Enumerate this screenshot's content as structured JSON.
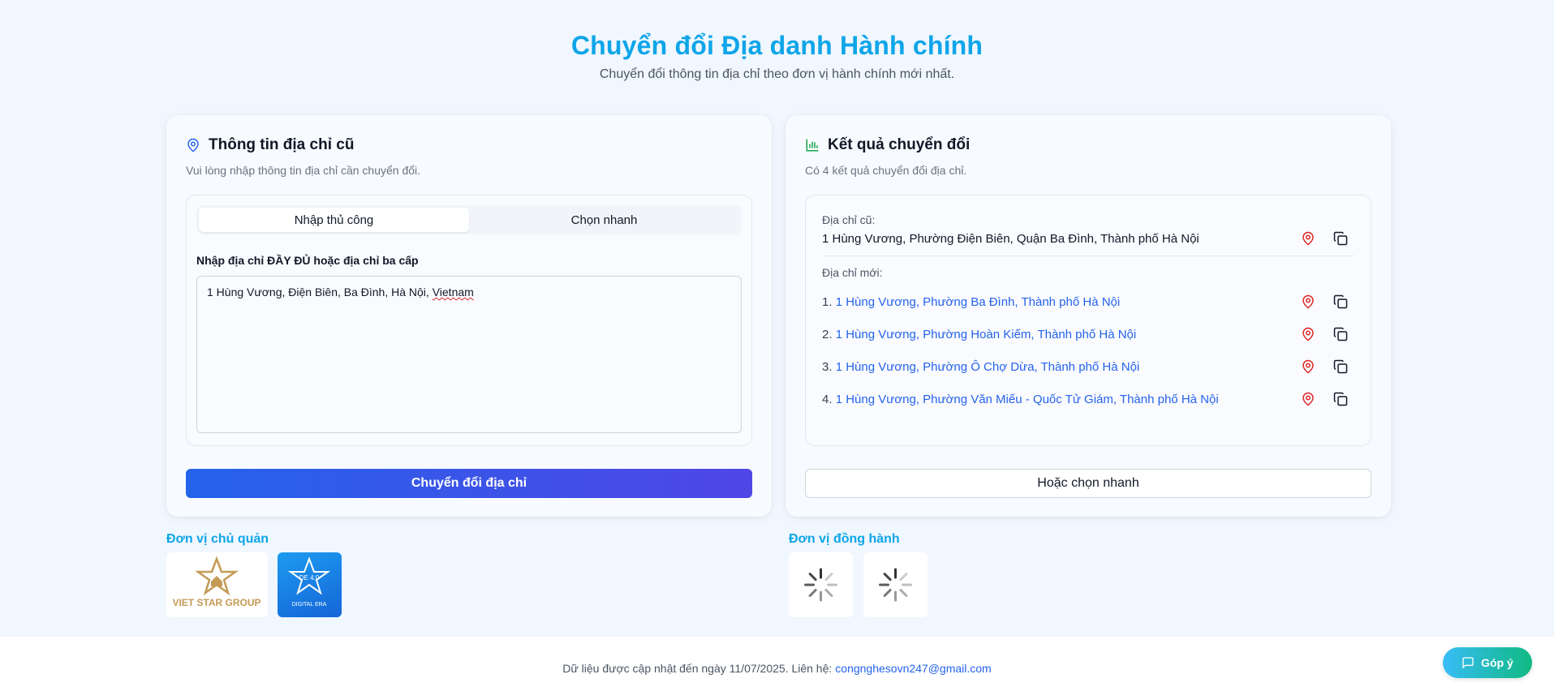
{
  "header": {
    "title": "Chuyển đổi Địa danh Hành chính",
    "subtitle": "Chuyển đổi thông tin địa chỉ theo đơn vị hành chính mới nhất."
  },
  "old_panel": {
    "title": "Thông tin địa chỉ cũ",
    "description": "Vui lòng nhập thông tin địa chỉ cần chuyển đổi.",
    "tabs": [
      {
        "label": "Nhập thủ công",
        "active": true
      },
      {
        "label": "Chọn nhanh",
        "active": false
      }
    ],
    "field_label": "Nhập địa chỉ ĐẦY ĐỦ hoặc địa chỉ ba cấp",
    "input_value_main": "1 Hùng Vương, Điện Biên, Ba Đình, Hà Nội, ",
    "input_value_spell": "Vietnam",
    "submit_label": "Chuyển đổi địa chỉ"
  },
  "result_panel": {
    "title": "Kết quả chuyển đổi",
    "description": "Có 4 kết quả chuyển đổi địa chỉ.",
    "old_label": "Địa chỉ cũ:",
    "old_address": "1 Hùng Vương, Phường Điện Biên, Quận Ba Đình, Thành phố Hà Nội",
    "new_label": "Địa chỉ mới:",
    "new_addresses": [
      {
        "index": "1.",
        "text": "1 Hùng Vương, Phường Ba Đình, Thành phố Hà Nội"
      },
      {
        "index": "2.",
        "text": "1 Hùng Vương, Phường Hoàn Kiếm, Thành phố Hà Nội"
      },
      {
        "index": "3.",
        "text": "1 Hùng Vương, Phường Ô Chợ Dừa, Thành phố Hà Nội"
      },
      {
        "index": "4.",
        "text": "1 Hùng Vương, Phường Văn Miếu - Quốc Tử Giám, Thành phố Hà Nội"
      }
    ],
    "quick_pick_label": "Hoặc chọn nhanh"
  },
  "sponsors": {
    "owner_label": "Đơn vị chủ quản",
    "partner_label": "Đơn vị đồng hành",
    "logos": [
      {
        "name": "VIET STAR GROUP"
      },
      {
        "name": "DE 4.0",
        "caption": "DIGITAL ERA"
      }
    ]
  },
  "footer": {
    "text": "Dữ liệu được cập nhật đến ngày 11/07/2025. Liên hệ:",
    "email": "congnghesovn247@gmail.com"
  },
  "feedback": {
    "label": "Góp ý"
  },
  "colors": {
    "accent": "#0ea5e9",
    "link": "#2563eb",
    "map_pin": "#dc2626",
    "chart_icon": "#16a34a"
  },
  "icons": [
    "map-pin-icon",
    "bar-chart-icon",
    "copy-icon",
    "message-icon",
    "spinner-icon"
  ]
}
